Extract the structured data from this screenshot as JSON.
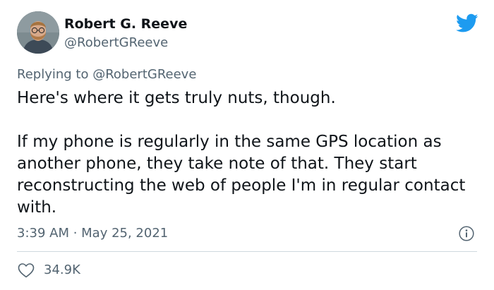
{
  "author": {
    "display_name": "Robert G. Reeve",
    "handle": "@RobertGReeve"
  },
  "reply": {
    "prefix": "Replying to ",
    "mention": "@RobertGReeve"
  },
  "body": {
    "paragraph_1": "Here's where it gets truly nuts, though.",
    "paragraph_2": "If my phone is regularly in the same GPS location as another phone, they take note of that. They start reconstructing the web of people I'm in regular contact with."
  },
  "meta": {
    "timestamp": "3:39 AM · May 25, 2021"
  },
  "engagement": {
    "likes": "34.9K"
  },
  "icons": {
    "brand": "twitter-bird-icon",
    "info": "info-icon",
    "like": "heart-icon"
  },
  "colors": {
    "brand_blue": "#1d9bf0",
    "text_primary": "#0f1419",
    "text_secondary": "#536471",
    "divider": "#cfd9de"
  }
}
